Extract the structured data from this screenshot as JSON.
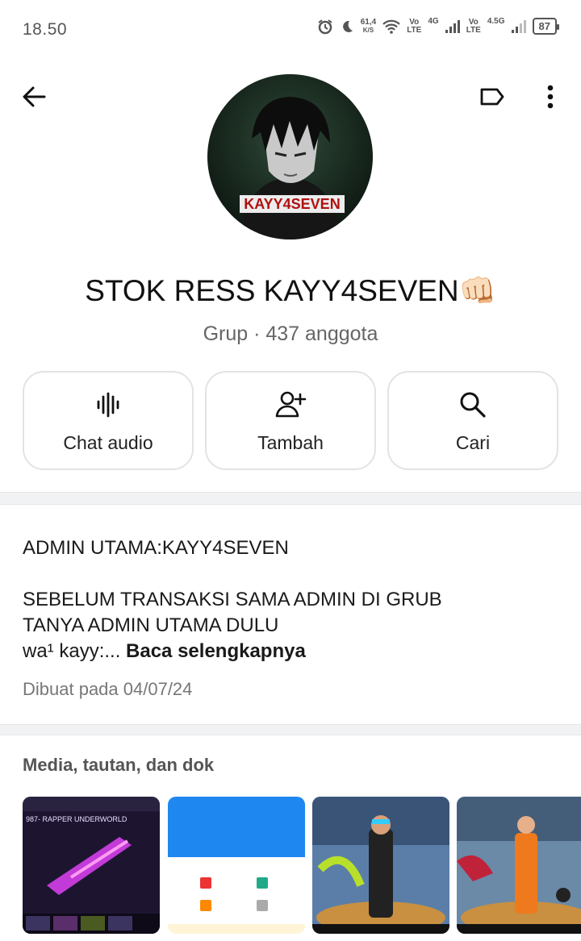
{
  "status": {
    "time": "18.50",
    "speed_value": "61,4",
    "speed_unit": "K/S",
    "net1_top": "Vo",
    "net1_bottom": "LTE",
    "net1_gen": "4G",
    "net2_top": "Vo",
    "net2_bottom": "LTE",
    "net2_gen": "4.5G",
    "battery": "87"
  },
  "group": {
    "name": "STOK RESS KAYY4SEVEN👊🏻",
    "meta": "Grup · 437 anggota",
    "avatar_text": "KAYY4SEVEN"
  },
  "actions": [
    {
      "label": "Chat audio",
      "icon": "audio-wave-icon"
    },
    {
      "label": "Tambah",
      "icon": "add-person-icon"
    },
    {
      "label": "Cari",
      "icon": "search-icon"
    }
  ],
  "description": {
    "text": "ADMIN UTAMA:KAYY4SEVEN\n\nSEBELUM TRANSAKSI SAMA ADMIN DI GRUB\nTANYA ADMIN UTAMA DULU\nwa¹ kayy:... ",
    "read_more": "Baca selengkapnya",
    "created": "Dibuat pada 04/07/24"
  },
  "media": {
    "title": "Media, tautan, dan dok",
    "thumb1_caption": "987- RAPPER UNDERWORLD"
  },
  "colors": {
    "divider": "#f1f2f3",
    "muted_text": "#666666",
    "accent": "#111111"
  }
}
